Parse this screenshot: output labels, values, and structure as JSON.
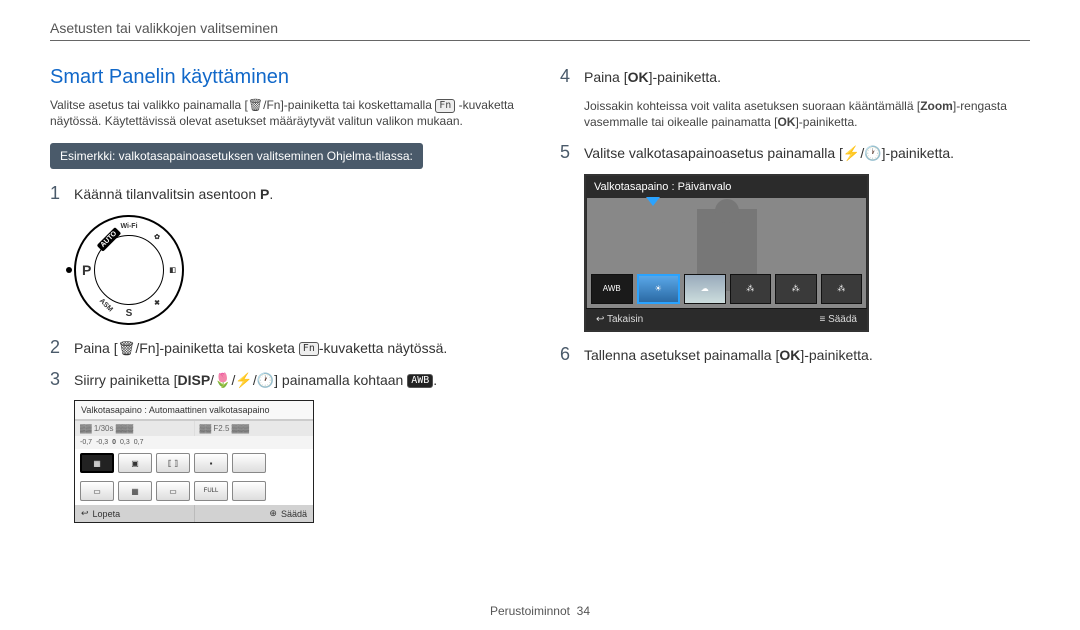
{
  "header": {
    "breadcrumb": "Asetusten tai valikkojen valitseminen"
  },
  "title": "Smart Panelin käyttäminen",
  "intro": {
    "l1a": "Valitse asetus tai valikko painamalla [",
    "l1b": "]-painiketta tai koskettamalla ",
    "fn_key": "Fn",
    "l2": "-kuvaketta näytössä. Käytettävissä olevat asetukset määräytyvät valitun valikon mukaan."
  },
  "example_bar": "Esimerkki: valkotasapainoasetuksen valitseminen Ohjelma-tilassa:",
  "step1": {
    "n": "1",
    "a": "Käännä tilanvalitsin asentoon ",
    "b": "P",
    "c": "."
  },
  "dial": {
    "auto": "AUTO",
    "wifi": "Wi-Fi",
    "asm": "ASM",
    "p": "P",
    "s": "S"
  },
  "step2": {
    "n": "2",
    "a": "Paina [",
    "b": "]-painiketta tai kosketa ",
    "fn": "Fn",
    "c": "-kuvaketta näytössä."
  },
  "step3": {
    "n": "3",
    "a": "Siirry painiketta [",
    "disp": "DISP",
    "b": "] painamalla kohtaan ",
    "awb": "AWB",
    "c": "."
  },
  "screen1": {
    "title": "Valkotasapaino : Automaattinen valkotasapaino",
    "shutter_hint": "1/30s",
    "aperture_hint": "F2.5",
    "scale": [
      "-0,7",
      "-0,3",
      "0",
      "0,3",
      "0,7"
    ],
    "lopeta_icon": "↩",
    "lopeta": "Lopeta",
    "saada_icon": "⊕",
    "saada": "Säädä"
  },
  "step4": {
    "n": "4",
    "a": "Paina [",
    "ok": "OK",
    "b": "]-painiketta."
  },
  "note4": {
    "a": "Joissakin kohteissa voit valita asetuksen suoraan kääntämällä [",
    "zoom": "Zoom",
    "b": "]-rengasta vasemmalle tai oikealle painamatta [",
    "ok": "OK",
    "c": "]-painiketta."
  },
  "step5": {
    "n": "5",
    "a": "Valitse valkotasapainoasetus painamalla [",
    "b": "]-painiketta."
  },
  "screen2": {
    "title": "Valkotasapaino : Päivänvalo",
    "awb": "AWB",
    "takaisin_icon": "↩",
    "takaisin": "Takaisin",
    "saada_icon": "≡",
    "saada": "Säädä"
  },
  "step6": {
    "n": "6",
    "a": "Tallenna asetukset painamalla [",
    "ok": "OK",
    "b": "]-painiketta."
  },
  "footer": {
    "section": "Perustoiminnot",
    "page": "34"
  }
}
